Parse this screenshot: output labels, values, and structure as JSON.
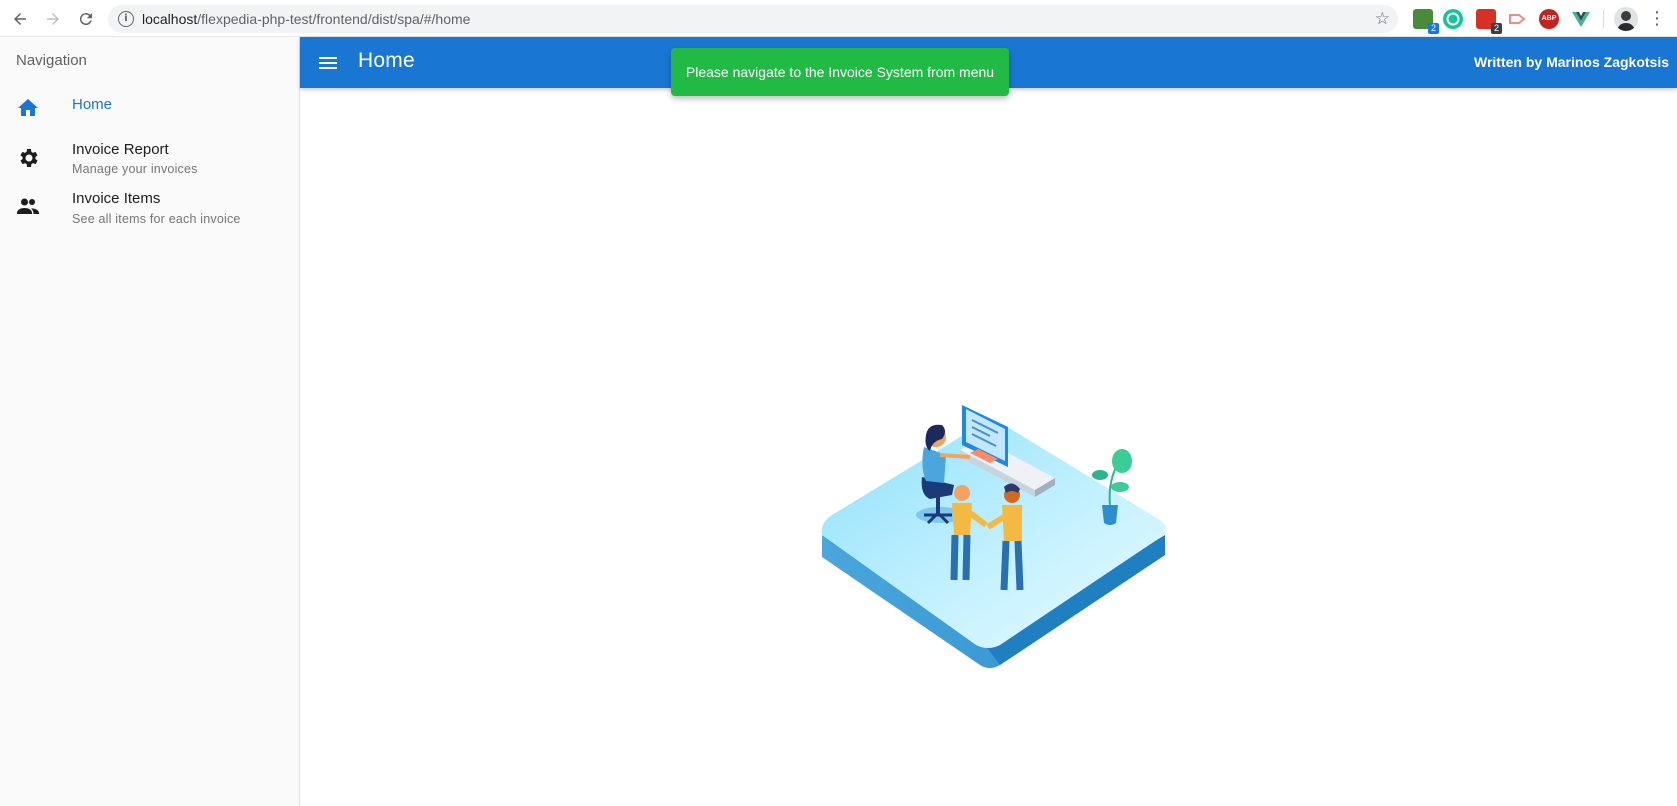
{
  "browser": {
    "url_host": "localhost",
    "url_path": "/flexpedia-php-test/frontend/dist/spa/#/home",
    "extension_badge_1": "2",
    "extension_badge_2": "2",
    "extension_abp": "ABP",
    "icons": [
      "back-arrow-icon",
      "forward-arrow-icon",
      "reload-icon",
      "info-icon",
      "star-icon",
      "extension-icons",
      "profile-avatar",
      "kebab-menu-icon"
    ]
  },
  "drawer": {
    "header": "Navigation",
    "items": [
      {
        "label": "Home",
        "caption": "",
        "icon": "home-icon",
        "active": true
      },
      {
        "label": "Invoice Report",
        "caption": "Manage your invoices",
        "icon": "gear-icon",
        "active": false
      },
      {
        "label": "Invoice Items",
        "caption": "See all items for each invoice",
        "icon": "people-icon",
        "active": false
      }
    ]
  },
  "header": {
    "title": "Home",
    "author": "Written by Marinos Zagkotsis",
    "menu_icon": "hamburger-menu-icon"
  },
  "toast": {
    "message": "Please navigate to the Invoice System from menu"
  },
  "colors": {
    "primary": "#1976d2",
    "toast": "#21ba45",
    "drawer_bg": "#fafafa"
  }
}
